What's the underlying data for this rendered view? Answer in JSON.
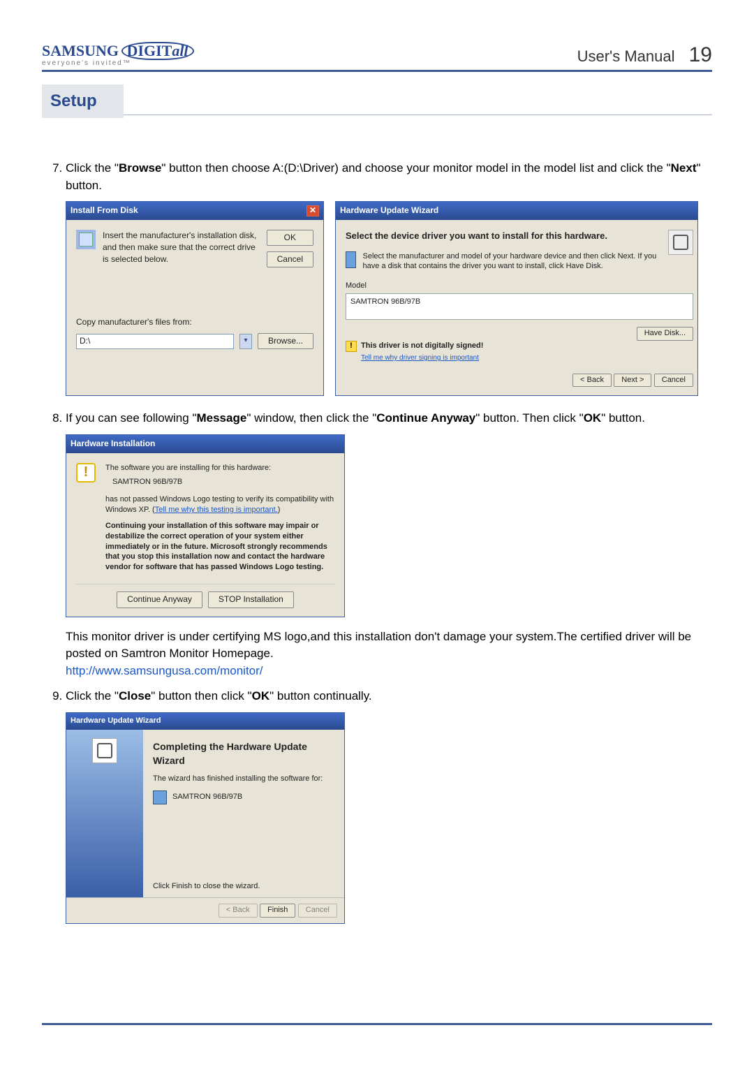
{
  "header": {
    "logo_main_a": "SAMSUNG",
    "logo_main_b": "DIGIT",
    "logo_main_c": "all",
    "logo_sub": "everyone's invited™",
    "manual_label": "User's  Manual",
    "page_number": "19"
  },
  "setup_tab": "Setup",
  "steps": {
    "s7": {
      "num": "7.",
      "text_a": "Click the \"",
      "bold_a": "Browse",
      "text_b": "\" button then choose A:(D:\\Driver) and choose your monitor model in the model list and click the \"",
      "bold_b": "Next",
      "text_c": "\" button."
    },
    "s8": {
      "num": "8.",
      "text_a": "If you can see following \"",
      "bold_a": "Message",
      "text_b": "\" window, then click the \"",
      "bold_b": "Continue Anyway",
      "text_c": "\" button. Then click \"",
      "bold_c": "OK",
      "text_d": "\" button."
    },
    "s8_note": "This monitor driver is under certifying MS logo,and this installation don't damage your system.The certified driver will be posted on Samtron Monitor Homepage.",
    "s8_link": "http://www.samsungusa.com/monitor/",
    "s9": {
      "num": "9.",
      "text_a": "Click the \"",
      "bold_a": "Close",
      "text_b": "\" button then click \"",
      "bold_b": "OK",
      "text_c": "\" button continually."
    }
  },
  "dlg_install_from_disk": {
    "title": "Install From Disk",
    "instruction": "Insert the manufacturer's installation disk, and then make sure that the correct drive is selected below.",
    "ok": "OK",
    "cancel": "Cancel",
    "copy_label": "Copy manufacturer's files from:",
    "combo_value": "D:\\",
    "browse": "Browse..."
  },
  "dlg_huw1": {
    "title": "Hardware Update Wizard",
    "heading": "Select the device driver you want to install for this hardware.",
    "subtext": "Select the manufacturer and model of your hardware device and then click Next. If you have a disk that contains the driver you want to install, click Have Disk.",
    "model_label": "Model",
    "model_value": "SAMTRON 96B/97B",
    "warn": "This driver is not digitally signed!",
    "tell": "Tell me why driver signing is important",
    "have_disk": "Have Disk...",
    "back": "< Back",
    "next": "Next >",
    "cancel": "Cancel"
  },
  "dlg_hinst": {
    "title": "Hardware Installation",
    "line1": "The software you are installing for this hardware:",
    "model": "SAMTRON 96B/97B",
    "line2a": "has not passed Windows Logo testing to verify its compatibility with Windows XP. (",
    "line2_link": "Tell me why this testing is important.",
    "line2b": ")",
    "bold": "Continuing your installation of this software may impair or destabilize the correct operation of your system either immediately or in the future. Microsoft strongly recommends that you stop this installation now and contact the hardware vendor for software that has passed Windows Logo testing.",
    "continue": "Continue Anyway",
    "stop": "STOP Installation"
  },
  "dlg_huw2": {
    "title": "Hardware Update Wizard",
    "heading": "Completing the Hardware Update Wizard",
    "sub": "The wizard has finished installing the software for:",
    "model": "SAMTRON 96B/97B",
    "finish_txt": "Click Finish to close the wizard.",
    "back": "< Back",
    "finish": "Finish",
    "cancel": "Cancel"
  }
}
